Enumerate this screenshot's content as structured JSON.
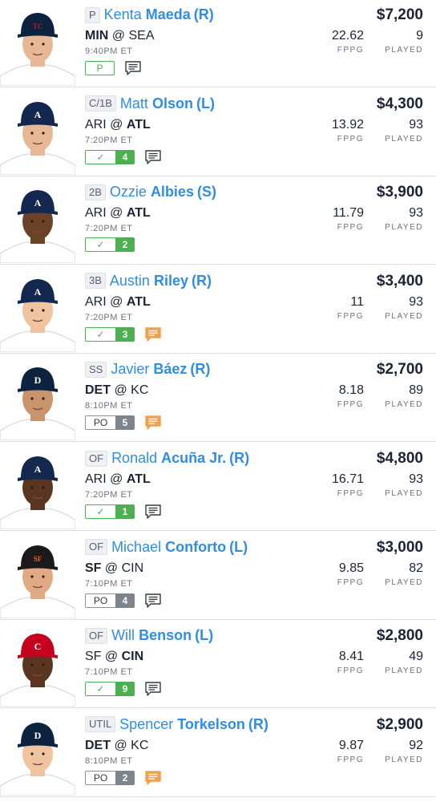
{
  "players": [
    {
      "pos": "P",
      "first": "Kenta",
      "last": "Maeda",
      "hand": "(R)",
      "matchup": {
        "away": "MIN",
        "home": "SEA",
        "bold": "away"
      },
      "time": "9:40PM ET",
      "tag": {
        "label": "P",
        "num": "",
        "kind": "solo"
      },
      "note": "gray",
      "price": "$7,200",
      "fppg": "22.62",
      "played": "9",
      "team": {
        "cap": "#0c2340",
        "logo": "TC",
        "logo_color": "#c8102e",
        "skin": "#e8b896"
      }
    },
    {
      "pos": "C/1B",
      "first": "Matt",
      "last": "Olson",
      "hand": "(L)",
      "matchup": {
        "away": "ARI",
        "home": "ATL",
        "bold": "home"
      },
      "time": "7:20PM ET",
      "tag": {
        "label": "✓",
        "num": "4",
        "kind": "green"
      },
      "note": "gray",
      "price": "$4,300",
      "fppg": "13.92",
      "played": "93",
      "team": {
        "cap": "#13274f",
        "logo": "A",
        "logo_color": "#ffffff",
        "skin": "#e8b896"
      }
    },
    {
      "pos": "2B",
      "first": "Ozzie",
      "last": "Albies",
      "hand": "(S)",
      "matchup": {
        "away": "ARI",
        "home": "ATL",
        "bold": "home"
      },
      "time": "7:20PM ET",
      "tag": {
        "label": "✓",
        "num": "2",
        "kind": "green"
      },
      "note": "none",
      "price": "$3,900",
      "fppg": "11.79",
      "played": "93",
      "team": {
        "cap": "#13274f",
        "logo": "A",
        "logo_color": "#ffffff",
        "skin": "#6b4226"
      }
    },
    {
      "pos": "3B",
      "first": "Austin",
      "last": "Riley",
      "hand": "(R)",
      "matchup": {
        "away": "ARI",
        "home": "ATL",
        "bold": "home"
      },
      "time": "7:20PM ET",
      "tag": {
        "label": "✓",
        "num": "3",
        "kind": "green"
      },
      "note": "orange",
      "price": "$3,400",
      "fppg": "11",
      "played": "93",
      "team": {
        "cap": "#13274f",
        "logo": "A",
        "logo_color": "#ffffff",
        "skin": "#f0c4a0"
      }
    },
    {
      "pos": "SS",
      "first": "Javier",
      "last": "Báez",
      "hand": "(R)",
      "matchup": {
        "away": "DET",
        "home": "KC",
        "bold": "away"
      },
      "time": "8:10PM ET",
      "tag": {
        "label": "PO",
        "num": "5",
        "kind": "gray"
      },
      "note": "orange",
      "price": "$2,700",
      "fppg": "8.18",
      "played": "89",
      "team": {
        "cap": "#0c2340",
        "logo": "D",
        "logo_color": "#ffffff",
        "skin": "#c9936b"
      }
    },
    {
      "pos": "OF",
      "first": "Ronald",
      "last": "Acuña Jr.",
      "hand": "(R)",
      "matchup": {
        "away": "ARI",
        "home": "ATL",
        "bold": "home"
      },
      "time": "7:20PM ET",
      "tag": {
        "label": "✓",
        "num": "1",
        "kind": "green"
      },
      "note": "gray",
      "price": "$4,800",
      "fppg": "16.71",
      "played": "93",
      "team": {
        "cap": "#13274f",
        "logo": "A",
        "logo_color": "#ffffff",
        "skin": "#5a3620"
      }
    },
    {
      "pos": "OF",
      "first": "Michael",
      "last": "Conforto",
      "hand": "(L)",
      "matchup": {
        "away": "SF",
        "home": "CIN",
        "bold": "away"
      },
      "time": "7:10PM ET",
      "tag": {
        "label": "PO",
        "num": "4",
        "kind": "gray"
      },
      "note": "gray",
      "price": "$3,000",
      "fppg": "9.85",
      "played": "82",
      "team": {
        "cap": "#1a1a1a",
        "logo": "SF",
        "logo_color": "#fd5a1e",
        "skin": "#e0aa84"
      }
    },
    {
      "pos": "OF",
      "first": "Will",
      "last": "Benson",
      "hand": "(L)",
      "matchup": {
        "away": "SF",
        "home": "CIN",
        "bold": "home"
      },
      "time": "7:10PM ET",
      "tag": {
        "label": "✓",
        "num": "9",
        "kind": "green"
      },
      "note": "gray",
      "price": "$2,800",
      "fppg": "8.41",
      "played": "49",
      "team": {
        "cap": "#c6011f",
        "logo": "C",
        "logo_color": "#ffffff",
        "skin": "#5a3620"
      }
    },
    {
      "pos": "UTIL",
      "first": "Spencer",
      "last": "Torkelson",
      "hand": "(R)",
      "matchup": {
        "away": "DET",
        "home": "KC",
        "bold": "away"
      },
      "time": "8:10PM ET",
      "tag": {
        "label": "PO",
        "num": "2",
        "kind": "gray"
      },
      "note": "orange",
      "price": "$2,900",
      "fppg": "9.87",
      "played": "92",
      "team": {
        "cap": "#0c2340",
        "logo": "D",
        "logo_color": "#ffffff",
        "skin": "#f0c4a0"
      }
    }
  ],
  "labels": {
    "fppg": "FPPG",
    "played": "PLAYED",
    "at": "@"
  },
  "colors": {
    "accent": "#2f8de4",
    "green": "#4caf50",
    "orange": "#f0a050",
    "gray_icon": "#333a45"
  }
}
